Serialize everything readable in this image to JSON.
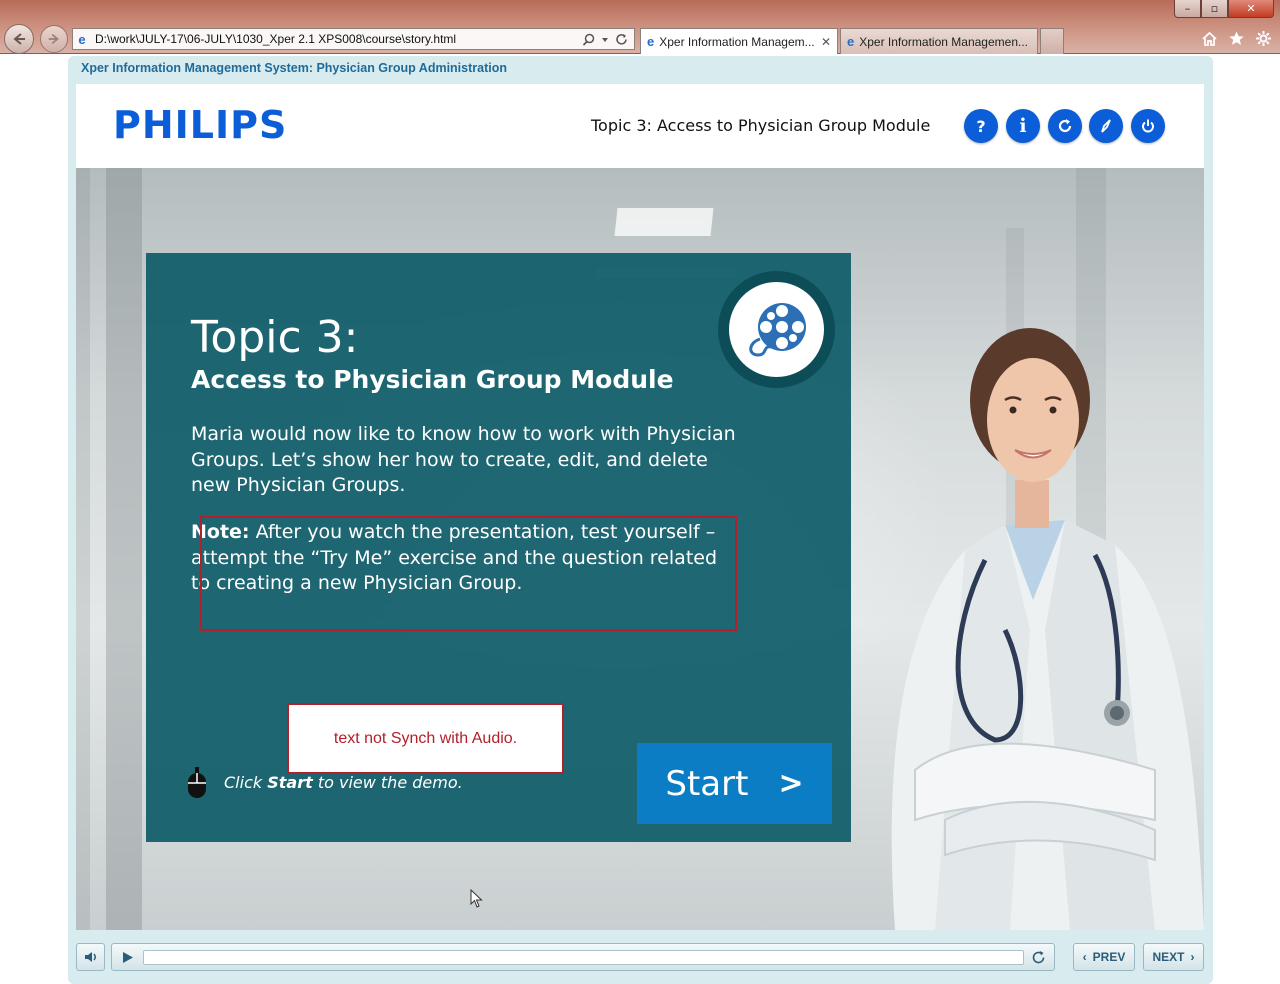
{
  "browser": {
    "url": "D:\\work\\JULY-17\\06-JULY\\1030_Xper 2.1 XPS008\\course\\story.html",
    "tabs": [
      {
        "label": "Xper Information Managem...",
        "active": true
      },
      {
        "label": "Xper Information Managemen...",
        "active": false
      }
    ],
    "window_controls": {
      "minimize": "–",
      "restore": "▫",
      "close": "✕"
    }
  },
  "course": {
    "title": "Xper Information Management System: Physician Group Administration",
    "logo_text": "PHILIPS",
    "header_topic": "Topic 3: Access to Physician Group Module",
    "header_buttons": [
      {
        "name": "help-button",
        "icon": "help-icon",
        "glyph": "?"
      },
      {
        "name": "info-button",
        "icon": "info-icon",
        "glyph": "i"
      },
      {
        "name": "replay-button",
        "icon": "refresh-icon",
        "glyph": "↻"
      },
      {
        "name": "resources-button",
        "icon": "compass-icon",
        "glyph": "✎"
      },
      {
        "name": "exit-button",
        "icon": "power-icon",
        "glyph": "⏻"
      }
    ]
  },
  "slide": {
    "topic_label": "Topic 3:",
    "topic_subtitle": "Access to Physician Group Module",
    "intro": "Maria would now like to know how to work with Physician Groups. Let’s show her how to create, edit, and delete new Physician Groups.",
    "note_label": "Note:",
    "note_text": " After you watch the presentation, test yourself – attempt the “Try Me” exercise and the question related to creating a new Physician Group.",
    "click_prefix": "Click ",
    "click_bold": "Start",
    "click_suffix": " to view the demo.",
    "start_label": "Start",
    "start_chevron": ">"
  },
  "review": {
    "callout_text": "text not Synch with Audio."
  },
  "controls": {
    "mute_glyph": "🔈",
    "play_glyph": "▶",
    "replay_glyph": "↻",
    "progress": 0,
    "prev_label": "PREV",
    "prev_chevron": "‹",
    "next_label": "NEXT",
    "next_chevron": "›"
  },
  "colors": {
    "philips_blue": "#0b5ed7",
    "teal_panel": "#0f5c68",
    "start_blue": "#0a7dc4",
    "review_red": "#b3202a"
  }
}
